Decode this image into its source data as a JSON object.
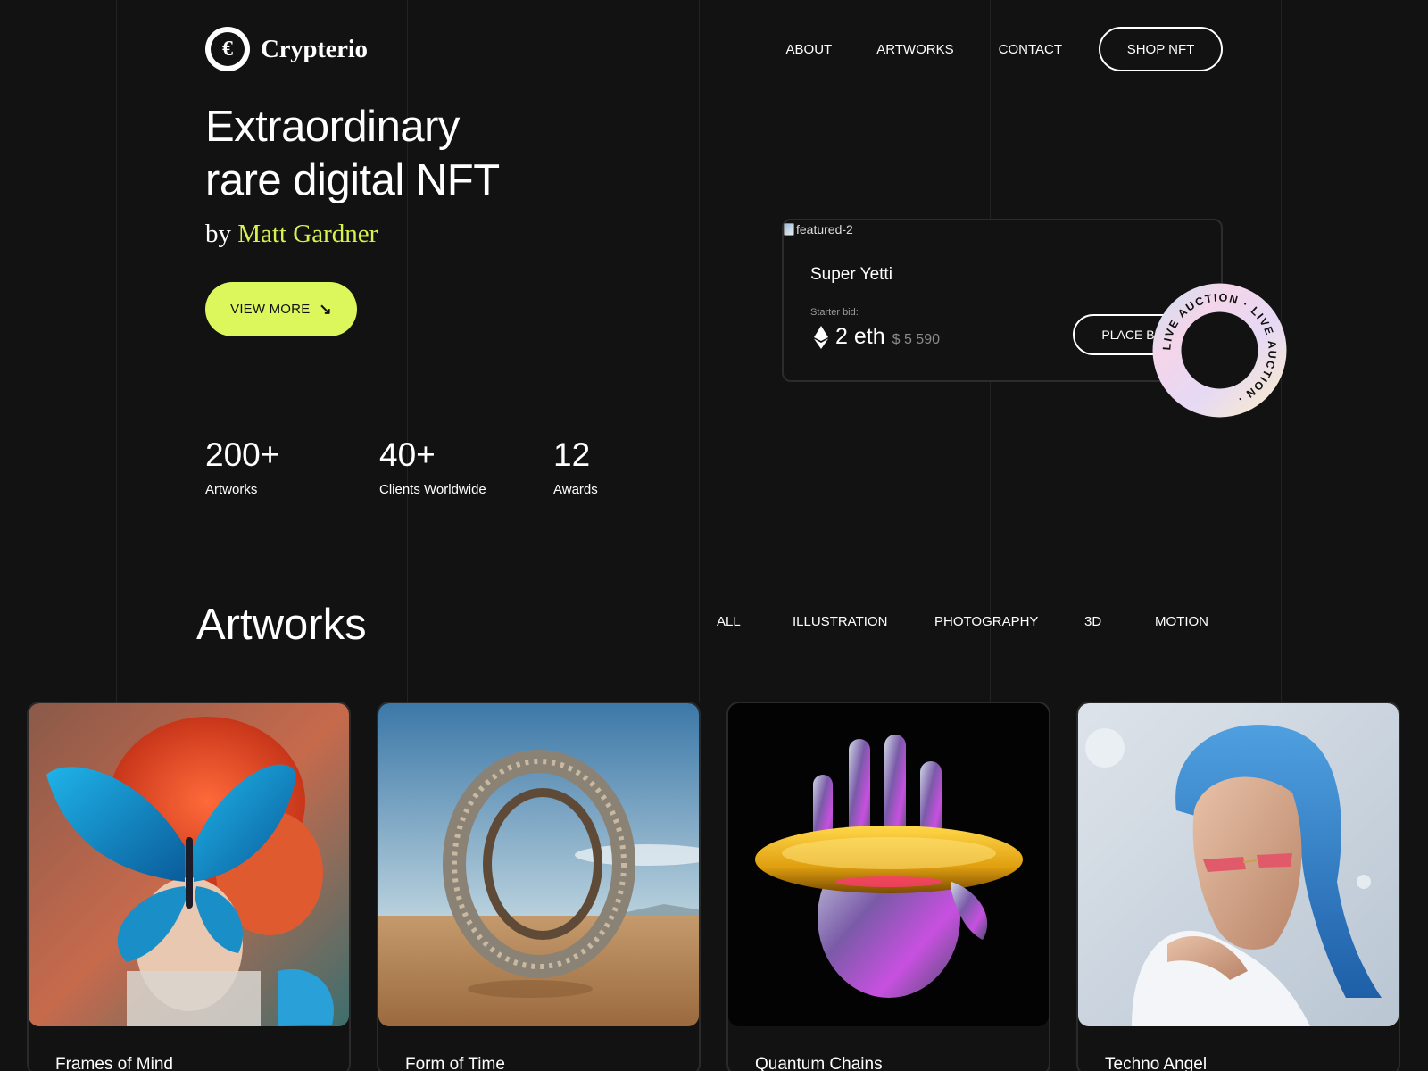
{
  "brand": {
    "name": "Crypterio",
    "mark": "€"
  },
  "nav": {
    "links": [
      "ABOUT",
      "ARTWORKS",
      "CONTACT"
    ],
    "shop_label": "SHOP NFT"
  },
  "hero": {
    "title_line1": "Extraordinary",
    "title_line2": "rare digital NFT",
    "by": "by",
    "artist": "Matt Gardner",
    "cta_label": "VIEW MORE",
    "cta_arrow": "↘"
  },
  "stats": [
    {
      "value": "200+",
      "label": "Artworks"
    },
    {
      "value": "40+",
      "label": "Clients Worldwide"
    },
    {
      "value": "12",
      "label": "Awards"
    }
  ],
  "featured": {
    "image_alt": "featured-2",
    "name": "Super Yetti",
    "bid_label": "Starter bid:",
    "eth": "2 eth",
    "usd": "$ 5 590",
    "button_label": "PLACE BID",
    "badge_text": "LIVE AUCTION · LIVE AUCTION · "
  },
  "artworks": {
    "title": "Artworks",
    "filters": [
      "ALL",
      "ILLUSTRATION",
      "PHOTOGRAPHY",
      "3D",
      "MOTION"
    ],
    "items": [
      {
        "title": "Frames of Mind"
      },
      {
        "title": "Form of Time"
      },
      {
        "title": "Quantum Chains"
      },
      {
        "title": "Techno Angel"
      }
    ]
  },
  "colors": {
    "background": "#121212",
    "accent": "#dcf75c",
    "accent_text": "#d6f24f"
  }
}
